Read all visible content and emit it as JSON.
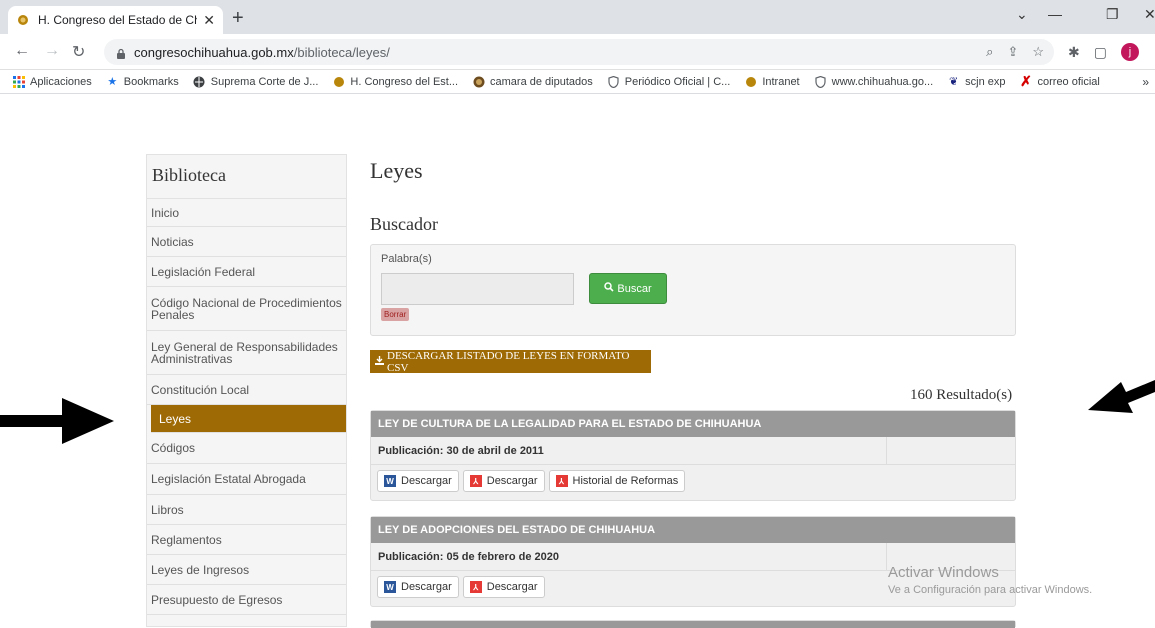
{
  "browser": {
    "tab_title": "H. Congreso del Estado de Chihu",
    "tab_close": "✕",
    "new_tab": "+",
    "url_host": "congresochihuahua.gob.mx",
    "url_path": "/biblioteca/leyes/",
    "avatar_letter": "j",
    "bookmarks": [
      {
        "label": "Aplicaciones",
        "icon": "apps-grid-icon"
      },
      {
        "label": "Bookmarks",
        "icon": "star-icon"
      },
      {
        "label": "Suprema Corte de J...",
        "icon": "globe-icon"
      },
      {
        "label": "H. Congreso del Est...",
        "icon": "eagle-icon"
      },
      {
        "label": "camara de diputados",
        "icon": "seal-icon"
      },
      {
        "label": "Periódico Oficial | C...",
        "icon": "shield-icon"
      },
      {
        "label": "Intranet",
        "icon": "eagle-icon"
      },
      {
        "label": "www.chihuahua.go...",
        "icon": "shield-icon"
      },
      {
        "label": "scjn exp",
        "icon": "scjn-icon"
      },
      {
        "label": "correo oficial",
        "icon": "x-icon"
      }
    ],
    "bookmarks_more": "»"
  },
  "sidebar": {
    "title": "Biblioteca",
    "items": [
      {
        "label": "Inicio"
      },
      {
        "label": "Noticias"
      },
      {
        "label": "Legislación Federal"
      },
      {
        "label": "Código Nacional de Procedimientos Penales"
      },
      {
        "label": "Ley General de Responsabilidades Administrativas"
      },
      {
        "label": "Constitución Local"
      },
      {
        "label": "Leyes"
      },
      {
        "label": "Códigos"
      },
      {
        "label": "Legislación Estatal Abrogada"
      },
      {
        "label": "Libros"
      },
      {
        "label": "Reglamentos"
      },
      {
        "label": "Leyes de Ingresos"
      },
      {
        "label": "Presupuesto de Egresos"
      }
    ],
    "active_item": "Leyes"
  },
  "main": {
    "title": "Leyes",
    "search_title": "Buscador",
    "search_label": "Palabra(s)",
    "search_value": "",
    "search_button": "Buscar",
    "clear_button": "Borrar",
    "csv_button": "DESCARGAR LISTADO DE LEYES EN FORMATO CSV",
    "results_count": "160 Resultado(s)",
    "laws": [
      {
        "title": "LEY DE CULTURA DE LA LEGALIDAD PARA EL ESTADO DE CHIHUAHUA",
        "publication": "Publicación: 30 de abril de 2011",
        "word_btn": "Descargar",
        "pdf_btn": "Descargar",
        "history_btn": "Historial de Reformas"
      },
      {
        "title": "LEY DE ADOPCIONES DEL ESTADO DE CHIHUAHUA",
        "publication": "Publicación: 05 de febrero de 2020",
        "word_btn": "Descargar",
        "pdf_btn": "Descargar"
      }
    ]
  },
  "watermark": {
    "line1": "Activar Windows",
    "line2": "Ve a Configuración para activar Windows."
  },
  "colors": {
    "accent_gold": "#9e6a05",
    "search_green": "#4cae4c",
    "law_header_gray": "#999999"
  }
}
